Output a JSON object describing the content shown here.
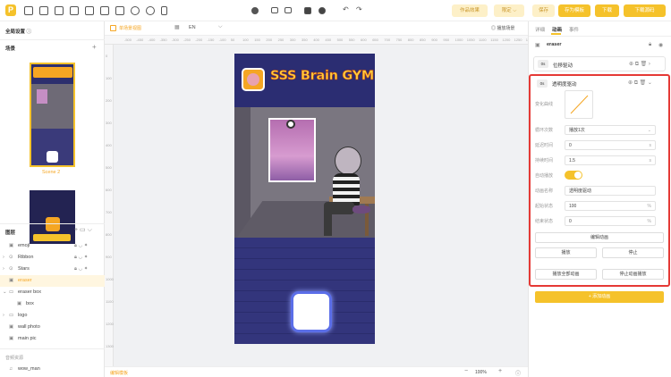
{
  "toolbar": {
    "works_effect": "作品效果",
    "publish": "限定",
    "save": "保存",
    "save_template": "存为模板",
    "download": "下载",
    "download_source": "下载源码"
  },
  "left": {
    "global_settings": "全局设置",
    "scenes_title": "场景",
    "scene2_label": "Scene 2",
    "layers_title": "图层",
    "layers": [
      {
        "label": "emoji"
      },
      {
        "label": "Ribbon"
      },
      {
        "label": "Stars"
      },
      {
        "label": "eraser"
      },
      {
        "label": "eraser box"
      },
      {
        "label": "box"
      },
      {
        "label": "logo"
      },
      {
        "label": "wall photo"
      },
      {
        "label": "main pic"
      }
    ],
    "audio_title": "音频资源",
    "audio_item": "wow_man"
  },
  "stage": {
    "toggle_label": "单场景视图",
    "lang": "EN",
    "play_scene": "播放场景",
    "ruler_top": [
      "-500",
      "-450",
      "-400",
      "-350",
      "-300",
      "-250",
      "-200",
      "-150",
      "-100",
      "50",
      "100",
      "150",
      "200",
      "250",
      "300",
      "350",
      "400",
      "450",
      "500",
      "550",
      "600",
      "650",
      "700",
      "750",
      "800",
      "850",
      "900",
      "950",
      "1000",
      "1050",
      "1100",
      "1150",
      "1200",
      "1250",
      "130"
    ],
    "ruler_left": [
      "0",
      "100",
      "200",
      "300",
      "400",
      "500",
      "600",
      "700",
      "800",
      "900",
      "1000",
      "1100",
      "1200",
      "1300"
    ],
    "canvas_title": "SSS Brain GYM",
    "bottom_left": "编辑模板",
    "zoom": "100%"
  },
  "right": {
    "tabs": [
      "详细",
      "动画",
      "事件"
    ],
    "element_name": "eraser",
    "anim1_time": "0s",
    "anim1_name": "位移驱动",
    "anim2_time": "0s",
    "anim2_name": "透明度驱动",
    "fields": {
      "curve_label": "变化曲线",
      "loop_label": "循环次数",
      "loop_value": "播放1次",
      "delay_label": "延迟时间",
      "delay_value": "0",
      "delay_unit": "s",
      "duration_label": "持续时间",
      "duration_value": "1.5",
      "duration_unit": "s",
      "autoplay_label": "自动播放",
      "name_label": "动画名称",
      "name_value": "透明度驱动",
      "start_label": "起始状态",
      "start_value": "100",
      "start_unit": "%",
      "end_label": "结束状态",
      "end_value": "0",
      "end_unit": "%"
    },
    "edit_anim": "编辑动画",
    "play": "播放",
    "stop": "停止",
    "play_all": "播放全部动画",
    "stop_all": "停止动画播放",
    "add_anim": "+ 添加动画"
  },
  "colors": {
    "accent": "#f5c22b",
    "orange": "#f5a623",
    "highlight": "#e53935"
  }
}
